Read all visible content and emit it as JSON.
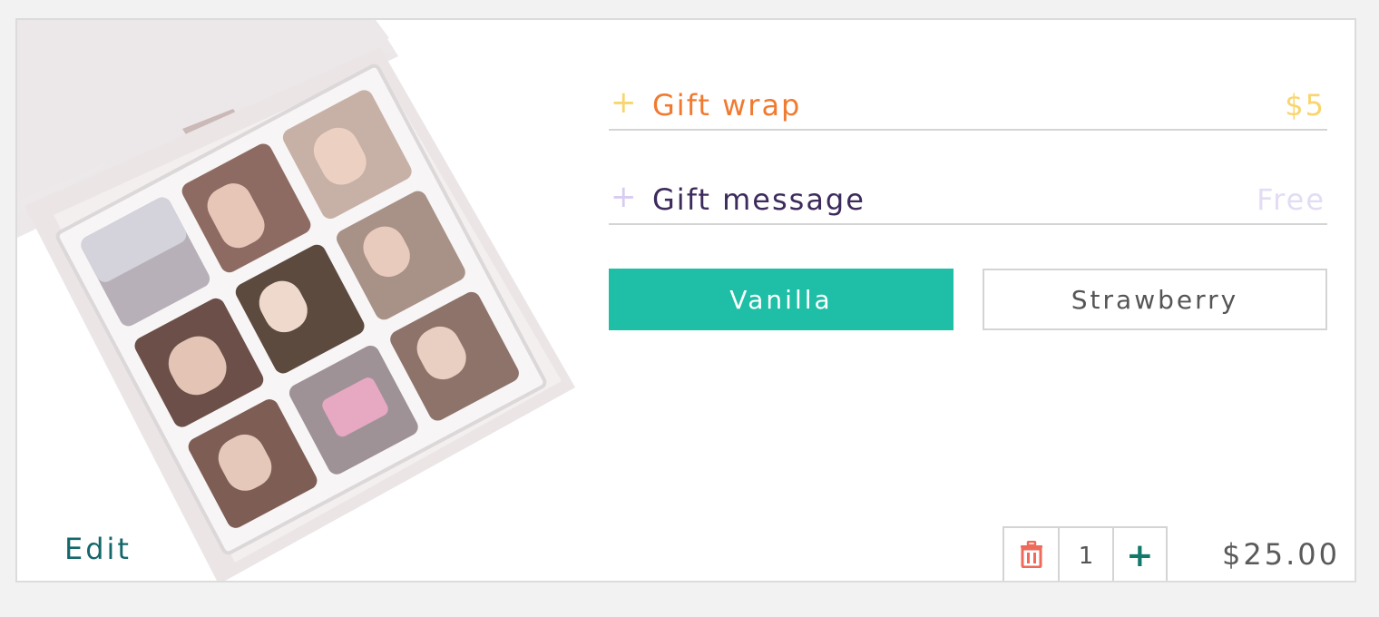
{
  "options": [
    {
      "label": "Gift wrap",
      "price": "$5",
      "plus": "+"
    },
    {
      "label": "Gift message",
      "price": "Free",
      "plus": "+"
    }
  ],
  "flavors": {
    "selected": "Vanilla",
    "alternate": "Strawberry"
  },
  "edit_label": "Edit",
  "quantity": {
    "value": "1",
    "increment": "+"
  },
  "line_total": "$25.00",
  "icons": {
    "delete": "trash-icon",
    "add": "plus-icon"
  },
  "colors": {
    "accent_teal": "#1fbea6",
    "gift_wrap_orange": "#f07a2f",
    "gift_message_purple": "#3d2b5c",
    "delete_red": "#ee6a5a",
    "edit_teal": "#14676a"
  }
}
